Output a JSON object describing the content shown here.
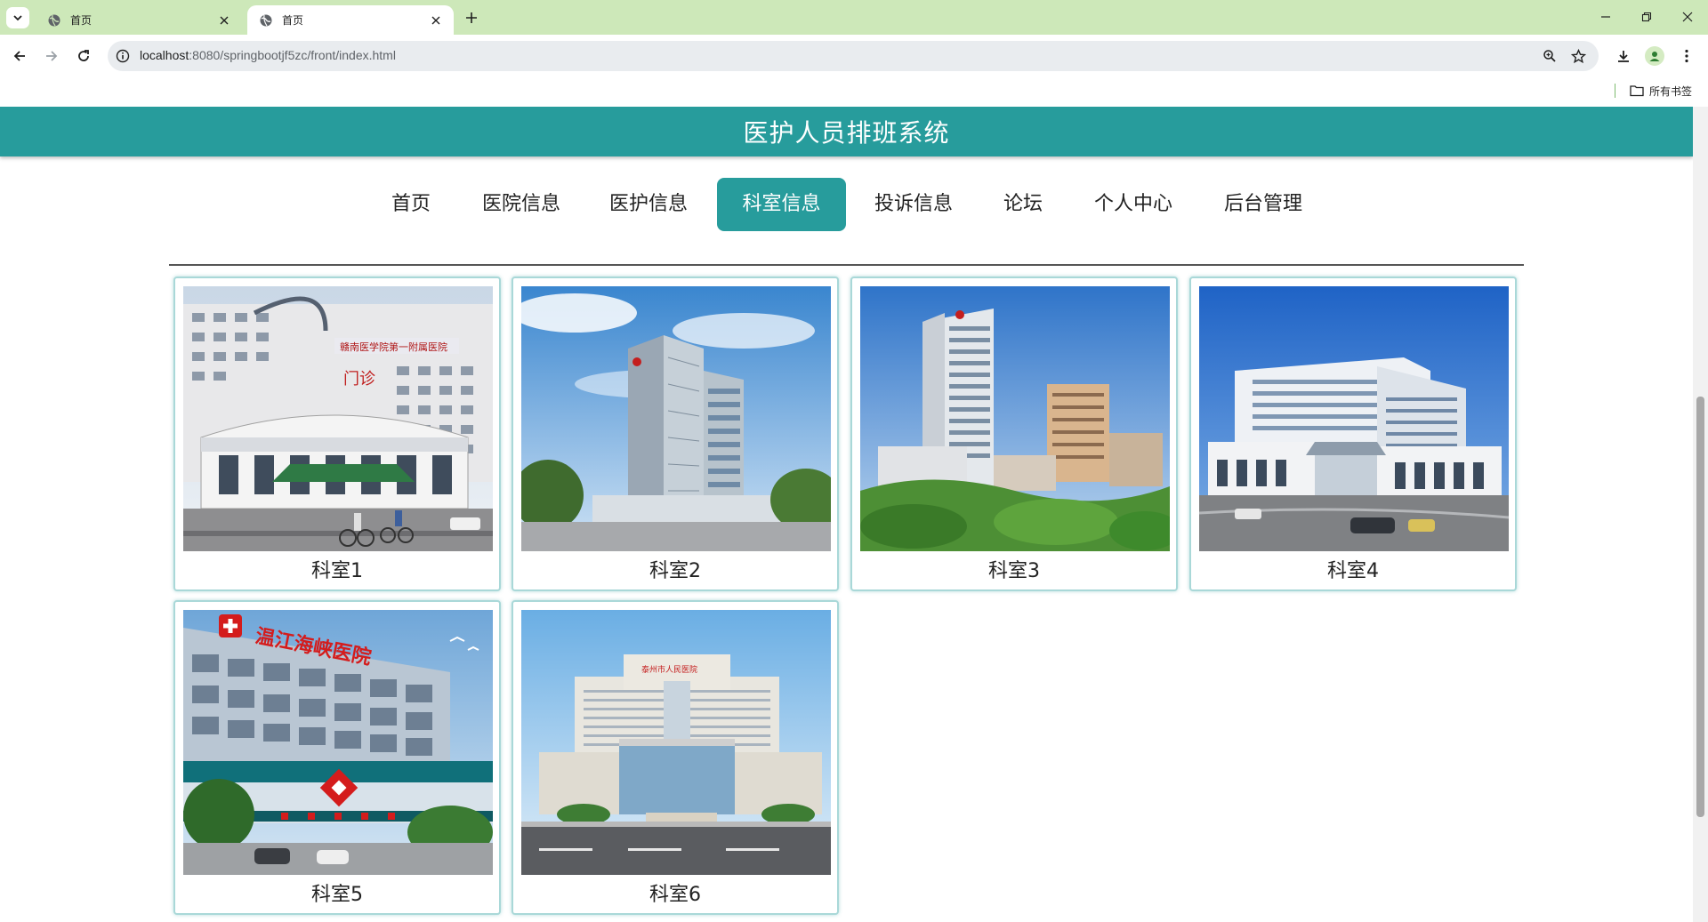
{
  "browser": {
    "tabs": [
      {
        "title": "首页",
        "active": false
      },
      {
        "title": "首页",
        "active": true
      }
    ],
    "url_host": "localhost",
    "url_path": ":8080/springbootjf5zc/front/index.html",
    "bookmarks_folder": "所有书签"
  },
  "site": {
    "title": "医护人员排班系统",
    "accent_color": "#279c9c"
  },
  "nav": [
    {
      "label": "首页",
      "active": false
    },
    {
      "label": "医院信息",
      "active": false
    },
    {
      "label": "医护信息",
      "active": false
    },
    {
      "label": "科室信息",
      "active": true
    },
    {
      "label": "投诉信息",
      "active": false
    },
    {
      "label": "论坛",
      "active": false
    },
    {
      "label": "个人中心",
      "active": false
    },
    {
      "label": "后台管理",
      "active": false
    }
  ],
  "departments": [
    {
      "name": "科室1"
    },
    {
      "name": "科室2"
    },
    {
      "name": "科室3"
    },
    {
      "name": "科室4"
    },
    {
      "name": "科室5"
    },
    {
      "name": "科室6"
    }
  ],
  "hospital_signs": {
    "card1": "赣南医学院第一附属医院",
    "card1_door": "门诊",
    "card5": "温江海峡医院",
    "card6": "泰州市人民医院"
  }
}
